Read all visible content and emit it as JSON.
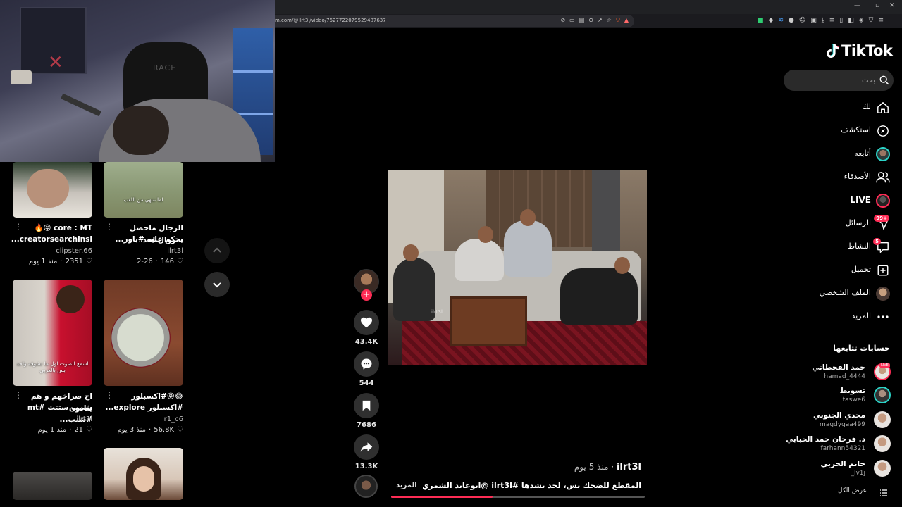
{
  "browser": {
    "url": "m.com/@ilrt3l/video/7627722079529487637"
  },
  "sidebar": {
    "logo": "TikTok",
    "search_placeholder": "بحث",
    "nav": [
      {
        "label": "لك",
        "icon": "home-icon"
      },
      {
        "label": "استكشف",
        "icon": "compass-icon"
      },
      {
        "label": "أتابعه",
        "icon": "following-avatar"
      },
      {
        "label": "الأصدقاء",
        "icon": "friends-icon"
      },
      {
        "label": "LIVE",
        "icon": "live-avatar"
      },
      {
        "label": "الرسائل",
        "icon": "messages-icon",
        "badge": "99+"
      },
      {
        "label": "النشاط",
        "icon": "activity-icon",
        "badge": "5"
      },
      {
        "label": "تحميل",
        "icon": "upload-icon"
      },
      {
        "label": "الملف الشخصي",
        "icon": "profile-avatar"
      },
      {
        "label": "المزيد",
        "icon": "more-icon"
      }
    ],
    "following_title": "حسابات تتابعها",
    "accounts": [
      {
        "name": "حمد القحطاني",
        "handle": "hamad_4444",
        "live": "LIVE"
      },
      {
        "name": "تسويط",
        "handle": "taswe6"
      },
      {
        "name": "مجدي الجنوبي",
        "handle": "magdygaa499"
      },
      {
        "name": "د. فرحان حمد الحبابي",
        "handle": "farhann54321"
      },
      {
        "name": "حاتم الحربي",
        "handle": "_lv1j"
      }
    ],
    "see_all": "عرض الكل"
  },
  "video": {
    "author": "ilrt3l",
    "time": " · منذ 5 يوم",
    "description": "المقطع للضحك بس، لحد يشدها #ilrt3l @ابوعابد الشمري .. @خلودى25 ...",
    "more": "المزيد",
    "watermark": "ilrt3l",
    "progress_fraction": 0.4
  },
  "actions": {
    "likes": "43.4K",
    "comments": "544",
    "saves": "7686",
    "shares": "13.3K"
  },
  "grid": [
    {
      "caption": "core : MT 😝🔥",
      "caption2": "creatorsearchinsi...",
      "author": "clipster.66",
      "likes": "2351",
      "time": "منذ 1 يوم"
    },
    {
      "caption": "الرجال ماحصل سروال لحد",
      "caption2": "يحكم عليه #باور...",
      "author": "ilrt3l",
      "likes": "146",
      "time": "2-26",
      "overlay": "لما ننتهي من اللعب"
    },
    {
      "caption": "اخ صراخهم و هم ينادون",
      "caption2": "شيبب ستتت #mt #شيب...",
      "author": "ilrt3l",
      "likes": "21",
      "time": "منذ 1 يوم",
      "overlay": "اسمع الصوت اول ما تشوفه واحد بس بالعربي"
    },
    {
      "caption": "😂😝#اكسبلور",
      "caption2": "#اكسبلور explore...",
      "author": "r1_c6",
      "likes": "56.8K",
      "time": "منذ 3 يوم"
    }
  ]
}
